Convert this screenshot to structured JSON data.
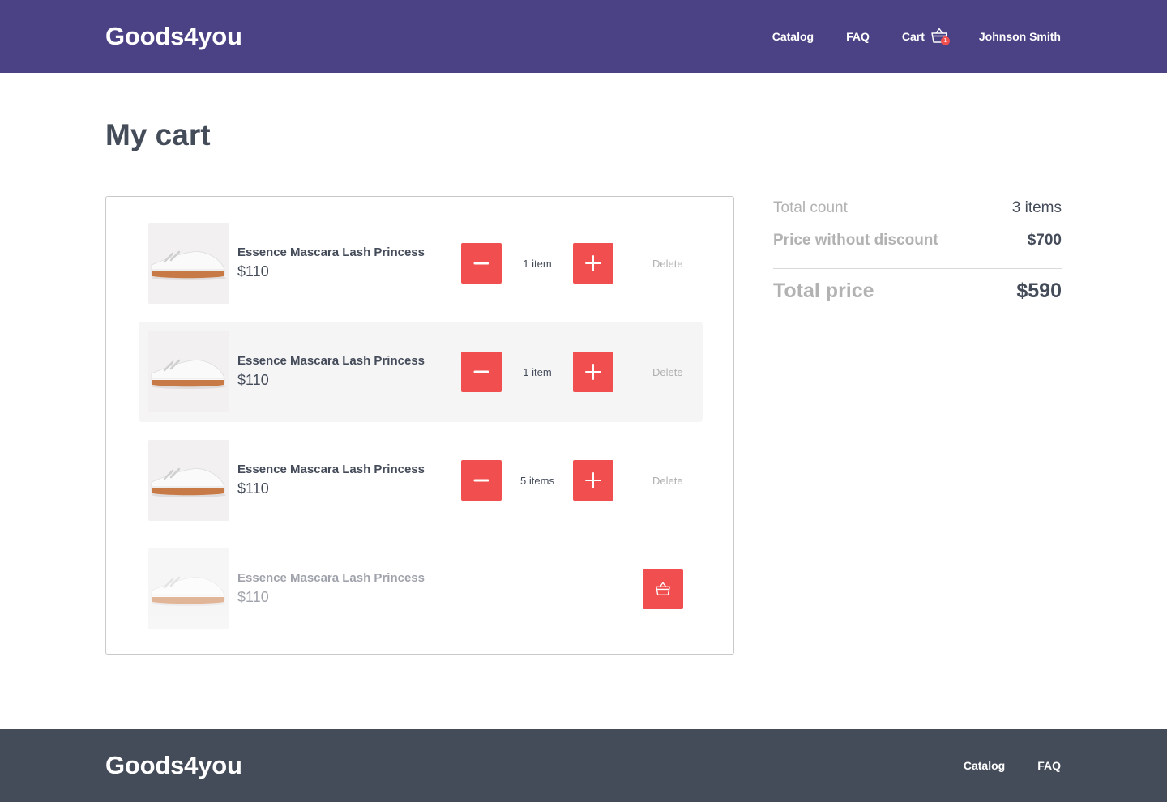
{
  "header": {
    "logo": "Goods4you",
    "nav": {
      "catalog": "Catalog",
      "faq": "FAQ",
      "cart": "Cart",
      "cart_badge": "1",
      "user": "Johnson Smith"
    }
  },
  "page": {
    "title": "My cart"
  },
  "cart": {
    "items": [
      {
        "name": "Essence Mascara Lash Princess",
        "price": "$110",
        "qty": "1 item",
        "delete": "Delete",
        "state": "normal"
      },
      {
        "name": "Essence Mascara Lash Princess",
        "price": "$110",
        "qty": "1 item",
        "delete": "Delete",
        "state": "hover"
      },
      {
        "name": "Essence Mascara Lash Princess",
        "price": "$110",
        "qty": "5 items",
        "delete": "Delete",
        "state": "normal"
      },
      {
        "name": "Essence Mascara Lash Princess",
        "price": "$110",
        "state": "removed"
      }
    ]
  },
  "summary": {
    "count_label": "Total count",
    "count_value": "3 items",
    "nodiscount_label": "Price without discount",
    "nodiscount_value": "$700",
    "total_label": "Total price",
    "total_value": "$590"
  },
  "footer": {
    "logo": "Goods4you",
    "nav": {
      "catalog": "Catalog",
      "faq": "FAQ"
    }
  },
  "icons": {
    "cart": "basket-icon",
    "minus": "minus-icon",
    "plus": "plus-icon",
    "restore": "basket-icon"
  },
  "colors": {
    "header_bg": "#4a4284",
    "footer_bg": "#444b59",
    "accent": "#f14f4f",
    "text": "#444b59",
    "muted": "#b2b2b2"
  }
}
